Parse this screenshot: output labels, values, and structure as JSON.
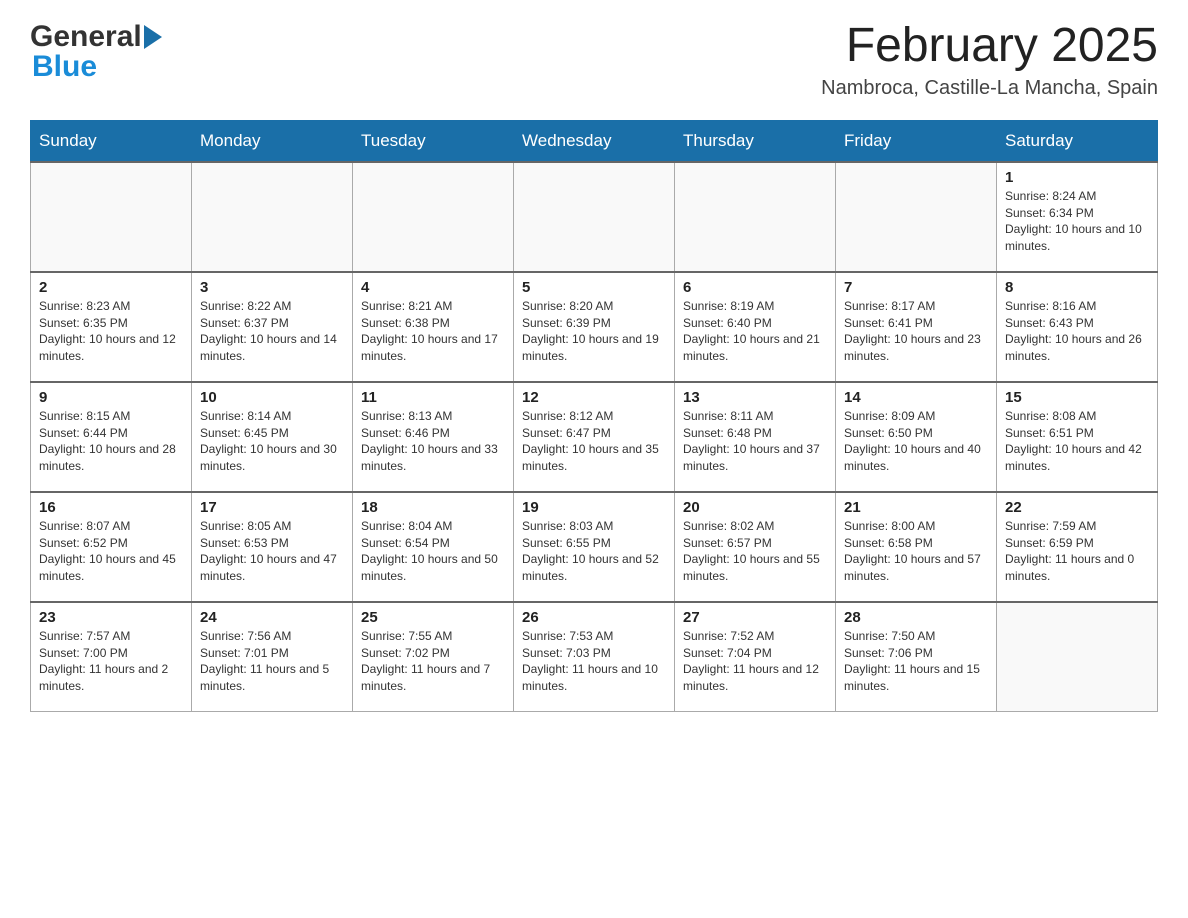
{
  "header": {
    "logo_general": "General",
    "logo_blue": "Blue",
    "month_title": "February 2025",
    "location": "Nambroca, Castille-La Mancha, Spain"
  },
  "weekdays": [
    "Sunday",
    "Monday",
    "Tuesday",
    "Wednesday",
    "Thursday",
    "Friday",
    "Saturday"
  ],
  "weeks": [
    {
      "days": [
        {
          "number": "",
          "info": ""
        },
        {
          "number": "",
          "info": ""
        },
        {
          "number": "",
          "info": ""
        },
        {
          "number": "",
          "info": ""
        },
        {
          "number": "",
          "info": ""
        },
        {
          "number": "",
          "info": ""
        },
        {
          "number": "1",
          "info": "Sunrise: 8:24 AM\nSunset: 6:34 PM\nDaylight: 10 hours and 10 minutes."
        }
      ]
    },
    {
      "days": [
        {
          "number": "2",
          "info": "Sunrise: 8:23 AM\nSunset: 6:35 PM\nDaylight: 10 hours and 12 minutes."
        },
        {
          "number": "3",
          "info": "Sunrise: 8:22 AM\nSunset: 6:37 PM\nDaylight: 10 hours and 14 minutes."
        },
        {
          "number": "4",
          "info": "Sunrise: 8:21 AM\nSunset: 6:38 PM\nDaylight: 10 hours and 17 minutes."
        },
        {
          "number": "5",
          "info": "Sunrise: 8:20 AM\nSunset: 6:39 PM\nDaylight: 10 hours and 19 minutes."
        },
        {
          "number": "6",
          "info": "Sunrise: 8:19 AM\nSunset: 6:40 PM\nDaylight: 10 hours and 21 minutes."
        },
        {
          "number": "7",
          "info": "Sunrise: 8:17 AM\nSunset: 6:41 PM\nDaylight: 10 hours and 23 minutes."
        },
        {
          "number": "8",
          "info": "Sunrise: 8:16 AM\nSunset: 6:43 PM\nDaylight: 10 hours and 26 minutes."
        }
      ]
    },
    {
      "days": [
        {
          "number": "9",
          "info": "Sunrise: 8:15 AM\nSunset: 6:44 PM\nDaylight: 10 hours and 28 minutes."
        },
        {
          "number": "10",
          "info": "Sunrise: 8:14 AM\nSunset: 6:45 PM\nDaylight: 10 hours and 30 minutes."
        },
        {
          "number": "11",
          "info": "Sunrise: 8:13 AM\nSunset: 6:46 PM\nDaylight: 10 hours and 33 minutes."
        },
        {
          "number": "12",
          "info": "Sunrise: 8:12 AM\nSunset: 6:47 PM\nDaylight: 10 hours and 35 minutes."
        },
        {
          "number": "13",
          "info": "Sunrise: 8:11 AM\nSunset: 6:48 PM\nDaylight: 10 hours and 37 minutes."
        },
        {
          "number": "14",
          "info": "Sunrise: 8:09 AM\nSunset: 6:50 PM\nDaylight: 10 hours and 40 minutes."
        },
        {
          "number": "15",
          "info": "Sunrise: 8:08 AM\nSunset: 6:51 PM\nDaylight: 10 hours and 42 minutes."
        }
      ]
    },
    {
      "days": [
        {
          "number": "16",
          "info": "Sunrise: 8:07 AM\nSunset: 6:52 PM\nDaylight: 10 hours and 45 minutes."
        },
        {
          "number": "17",
          "info": "Sunrise: 8:05 AM\nSunset: 6:53 PM\nDaylight: 10 hours and 47 minutes."
        },
        {
          "number": "18",
          "info": "Sunrise: 8:04 AM\nSunset: 6:54 PM\nDaylight: 10 hours and 50 minutes."
        },
        {
          "number": "19",
          "info": "Sunrise: 8:03 AM\nSunset: 6:55 PM\nDaylight: 10 hours and 52 minutes."
        },
        {
          "number": "20",
          "info": "Sunrise: 8:02 AM\nSunset: 6:57 PM\nDaylight: 10 hours and 55 minutes."
        },
        {
          "number": "21",
          "info": "Sunrise: 8:00 AM\nSunset: 6:58 PM\nDaylight: 10 hours and 57 minutes."
        },
        {
          "number": "22",
          "info": "Sunrise: 7:59 AM\nSunset: 6:59 PM\nDaylight: 11 hours and 0 minutes."
        }
      ]
    },
    {
      "days": [
        {
          "number": "23",
          "info": "Sunrise: 7:57 AM\nSunset: 7:00 PM\nDaylight: 11 hours and 2 minutes."
        },
        {
          "number": "24",
          "info": "Sunrise: 7:56 AM\nSunset: 7:01 PM\nDaylight: 11 hours and 5 minutes."
        },
        {
          "number": "25",
          "info": "Sunrise: 7:55 AM\nSunset: 7:02 PM\nDaylight: 11 hours and 7 minutes."
        },
        {
          "number": "26",
          "info": "Sunrise: 7:53 AM\nSunset: 7:03 PM\nDaylight: 11 hours and 10 minutes."
        },
        {
          "number": "27",
          "info": "Sunrise: 7:52 AM\nSunset: 7:04 PM\nDaylight: 11 hours and 12 minutes."
        },
        {
          "number": "28",
          "info": "Sunrise: 7:50 AM\nSunset: 7:06 PM\nDaylight: 11 hours and 15 minutes."
        },
        {
          "number": "",
          "info": ""
        }
      ]
    }
  ]
}
